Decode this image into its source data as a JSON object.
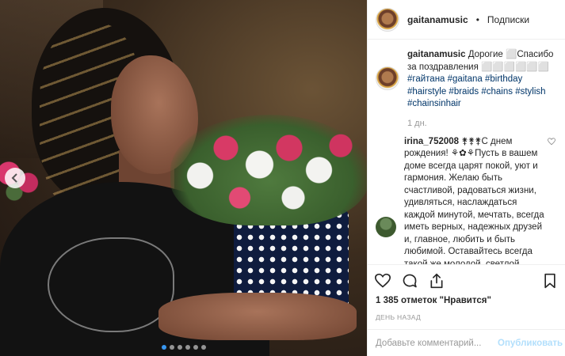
{
  "header": {
    "username": "gaitanamusic",
    "separator": "•",
    "follow_status": "Подписки"
  },
  "caption": {
    "username": "gaitanamusic",
    "text_before": "Дорогие ⬜Спасибо за поздравления ⬜⬜⬜⬜⬜⬜ ",
    "hashtags": [
      "#гайтана",
      "#gaitana",
      "#birthday",
      "#hairstyle",
      "#braids",
      "#chains",
      "#stylish",
      "#chainsinhair"
    ],
    "time": "1 дн."
  },
  "comment": {
    "username": "irina_752008",
    "text": "⚵⚵⚵С днем рождения! ⚘✿⚘Пусть в вашем доме всегда царят покой, уют и гармония. Желаю быть счастливой, радоваться жизни, удивляться, наслаждаться каждой минутой, мечтать, всегда иметь верных, надежных друзей и, главное, любить и быть любимой. Оставайтесь всегда такой же молодой, светлой, доброй, веселой и улыбчивой! Будьте счастливой"
  },
  "icons": {
    "like": "heart-icon",
    "comment": "comment-bubble-icon",
    "share": "share-icon",
    "save": "bookmark-icon",
    "carousel_prev": "chevron-left-icon"
  },
  "stats": {
    "likes": "1 385 отметок \"Нравится\"",
    "date": "ДЕНЬ НАЗАД"
  },
  "composer": {
    "placeholder": "Добавьте комментарий...",
    "publish_label": "Опубликовать"
  },
  "carousel": {
    "dot_count": 6,
    "active_index": 0
  },
  "colors": {
    "link": "#003569",
    "active_dot": "#3897f0",
    "publish_disabled": "#b2dffc"
  }
}
